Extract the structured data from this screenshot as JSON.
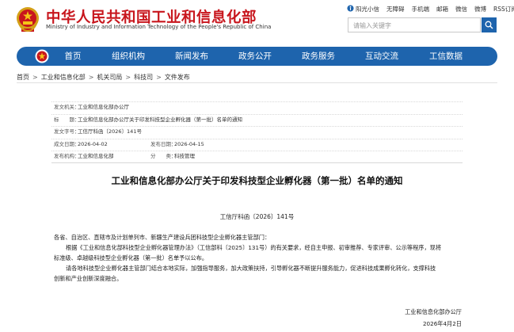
{
  "header": {
    "title": "中华人民共和国工业和信息化部",
    "subtitle": "Ministry of Industry and Information Technology of the People's Republic of China",
    "top_links": [
      "阳光小信",
      "无障碍",
      "手机端",
      "邮箱",
      "微信",
      "微博",
      "RSS订阅"
    ],
    "search_placeholder": "请输入关键字"
  },
  "nav": {
    "items": [
      "首页",
      "组织机构",
      "新闻发布",
      "政务公开",
      "政务服务",
      "互动交流",
      "工信数据"
    ]
  },
  "breadcrumb": [
    "首页",
    "工业和信息化部",
    "机关司局",
    "科技司",
    "文件发布"
  ],
  "info": {
    "issuer_label": "发文机关：",
    "issuer": "工业和信息化部办公厅",
    "title_label": "标　　题：",
    "title": "工业和信息化部办公厅关于印发科技型企业孵化器（第一批）名单的通知",
    "docno_label": "发文字号：",
    "docno": "工信厅科函〔2026〕141号",
    "created_label": "成文日期：",
    "created": "2026-04-02",
    "published_label": "发布日期：",
    "published": "2026-04-15",
    "org_label": "发布机构：",
    "org": "工业和信息化部",
    "category_label": "分　　类：",
    "category": "科技管理"
  },
  "article": {
    "title": "工业和信息化部办公厅关于印发科技型企业孵化器（第一批）名单的通知",
    "doc_no": "工信厅科函〔2026〕141号",
    "salutation": "各省、自治区、直辖市及计划单列市、新疆生产建设兵团科技型企业孵化器主管部门：",
    "p1_line1": "根据《工业和信息化部科技型企业孵化器管理办法》（工信部科〔2025〕131号）的有关要求，经自主申报、初审推荐、专家评审、公示等程序，现将",
    "p1_line2": "标准级、卓越级科技型企业孵化器（第一批）名单予以公布。",
    "p2_line1": "请各地科技型企业孵化器主管部门结合本地实际，加强指导服务，加大政策扶持，引导孵化器不断提升服务能力，促进科技成果孵化转化，支撑科技",
    "p2_line2": "创新和产业创新深度融合。",
    "sign_org": "工业和信息化部办公厅",
    "sign_date": "2026年4月2日"
  },
  "colors": {
    "brand_red": "#c8161d",
    "nav_blue": "#1e64ad"
  }
}
